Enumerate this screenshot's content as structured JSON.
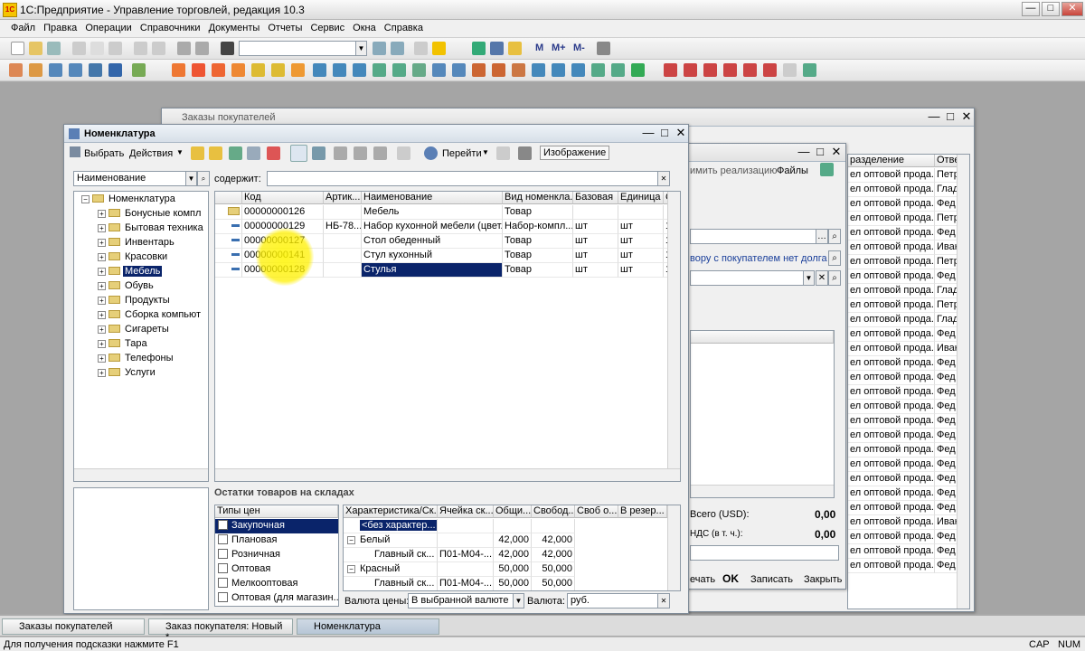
{
  "app": {
    "title": "1С:Предприятие - Управление торговлей, редакция 10.3",
    "icon_text": "1С"
  },
  "menu": [
    "Файл",
    "Правка",
    "Операции",
    "Справочники",
    "Документы",
    "Отчеты",
    "Сервис",
    "Окна",
    "Справка"
  ],
  "toolbar_labels": {
    "m": "M",
    "mplus": "M+",
    "mminus": "M-"
  },
  "orders_window": {
    "title": "Заказы покупателей"
  },
  "order_window": {
    "files_btn": "Файлы",
    "create_sale": "имить реализацию",
    "contract_text": "вору с покупателем нет долга",
    "total_label": "Всего (USD):",
    "total_value": "0,00",
    "vat_label": "НДС (в т. ч.):",
    "vat_value": "0,00",
    "buttons": {
      "print": "ечать",
      "ok": "OK",
      "save": "Записать",
      "close": "Закрыть"
    }
  },
  "right_table": {
    "headers": [
      "разделение",
      "Отве"
    ],
    "rows": [
      [
        "ел оптовой прода...",
        "Петр"
      ],
      [
        "ел оптовой прода...",
        "Глад"
      ],
      [
        "ел оптовой прода...",
        "Фед"
      ],
      [
        "ел оптовой прода...",
        "Петр"
      ],
      [
        "ел оптовой прода...",
        "Фед"
      ],
      [
        "ел оптовой прода...",
        "Иван"
      ],
      [
        "ел оптовой прода...",
        "Петр"
      ],
      [
        "ел оптовой прода...",
        "Фед"
      ],
      [
        "ел оптовой прода...",
        "Глад"
      ],
      [
        "ел оптовой прода...",
        "Петр"
      ],
      [
        "ел оптовой прода...",
        "Глад"
      ],
      [
        "ел оптовой прода...",
        "Фед"
      ],
      [
        "ел оптовой прода...",
        "Иван"
      ],
      [
        "ел оптовой прода...",
        "Фед"
      ],
      [
        "ел оптовой прода...",
        "Фед"
      ],
      [
        "ел оптовой прода...",
        "Фед"
      ],
      [
        "ел оптовой прода...",
        "Фед"
      ],
      [
        "ел оптовой прода...",
        "Фед"
      ],
      [
        "ел оптовой прода...",
        "Фед"
      ],
      [
        "ел оптовой прода...",
        "Фед"
      ],
      [
        "ел оптовой прода...",
        "Фед"
      ],
      [
        "ел оптовой прода...",
        "Фед"
      ],
      [
        "ел оптовой прода...",
        "Фед"
      ],
      [
        "ел оптовой прода...",
        "Фед"
      ],
      [
        "ел оптовой прода...",
        "Иван"
      ],
      [
        "ел оптовой прода...",
        "Фед"
      ],
      [
        "ел оптовой прода...",
        "Фед"
      ],
      [
        "ел оптовой прода...",
        "Фед"
      ]
    ]
  },
  "nomenclature": {
    "title": "Номенклатура",
    "toolbar": {
      "select": "Выбрать",
      "actions": "Действия",
      "goto": "Перейти",
      "image": "Изображение"
    },
    "search_field": "Наименование",
    "contains_label": "содержит:",
    "contains_value": "",
    "tree": [
      {
        "label": "Номенклатура",
        "level": 0,
        "expanded": true
      },
      {
        "label": "Бонусные компл",
        "level": 1
      },
      {
        "label": "Бытовая техника",
        "level": 1
      },
      {
        "label": "Инвентарь",
        "level": 1
      },
      {
        "label": "Красовки",
        "level": 1
      },
      {
        "label": "Мебель",
        "level": 1,
        "selected": true
      },
      {
        "label": "Обувь",
        "level": 1
      },
      {
        "label": "Продукты",
        "level": 1
      },
      {
        "label": "Сборка компьют",
        "level": 1
      },
      {
        "label": "Сигареты",
        "level": 1
      },
      {
        "label": "Тара",
        "level": 1
      },
      {
        "label": "Телефоны",
        "level": 1
      },
      {
        "label": "Услуги",
        "level": 1
      }
    ],
    "columns": [
      "Код",
      "Артик...",
      "Наименование",
      "Вид номенкла...",
      "Базовая",
      "Единица",
      "С"
    ],
    "rows": [
      {
        "code": "00000000126",
        "art": "",
        "name": "Мебель",
        "kind": "Товар",
        "base": "",
        "unit": "",
        "c": "",
        "folder": true
      },
      {
        "code": "00000000129",
        "art": "НБ-78...",
        "name": "Набор кухонной мебели (цвет...",
        "kind": "Набор-компл...",
        "base": "шт",
        "unit": "шт",
        "c": "1"
      },
      {
        "code": "00000000127",
        "art": "",
        "name": "Стол обеденный",
        "kind": "Товар",
        "base": "шт",
        "unit": "шт",
        "c": "1"
      },
      {
        "code": "00000000141",
        "art": "",
        "name": "Стул кухонный",
        "kind": "Товар",
        "base": "шт",
        "unit": "шт",
        "c": "1"
      },
      {
        "code": "00000000128",
        "art": "",
        "name": "Стулья",
        "kind": "Товар",
        "base": "шт",
        "unit": "шт",
        "c": "1",
        "selected": true
      }
    ],
    "stock_title": "Остатки товаров на складах",
    "price_types_header": "Типы цен",
    "price_types": [
      {
        "label": "Закупочная",
        "selected": true
      },
      {
        "label": "Плановая"
      },
      {
        "label": "Розничная"
      },
      {
        "label": "Оптовая"
      },
      {
        "label": "Мелкооптовая"
      },
      {
        "label": "Оптовая (для магазин..."
      }
    ],
    "stock_columns": [
      "Характеристика/Ск...",
      "Ячейка ск...",
      "Общи...",
      "Свобод...",
      "Своб о...",
      "В резер..."
    ],
    "stock_rows": [
      {
        "label": "<без характер...",
        "cell": "",
        "total": "",
        "free": "",
        "selected": true,
        "level": 1
      },
      {
        "label": "Белый",
        "cell": "",
        "total": "42,000",
        "free": "42,000",
        "level": 0,
        "tree": true
      },
      {
        "label": "Главный ск...",
        "cell": "П01-М04-...",
        "total": "42,000",
        "free": "42,000",
        "level": 2
      },
      {
        "label": "Красный",
        "cell": "",
        "total": "50,000",
        "free": "50,000",
        "level": 0,
        "tree": true
      },
      {
        "label": "Главный ск...",
        "cell": "П01-М04-...",
        "total": "50,000",
        "free": "50,000",
        "level": 2
      }
    ],
    "currency_label": "Валюта цены:",
    "currency_value": "В выбранной валюте",
    "currency2_label": "Валюта:",
    "currency2_value": "руб."
  },
  "taskbar": [
    {
      "label": "Заказы покупателей"
    },
    {
      "label": "Заказ покупателя: Новый *"
    },
    {
      "label": "Номенклатура",
      "active": true
    }
  ],
  "status": {
    "hint": "Для получения подсказки нажмите F1",
    "cap": "CAP",
    "num": "NUM"
  }
}
